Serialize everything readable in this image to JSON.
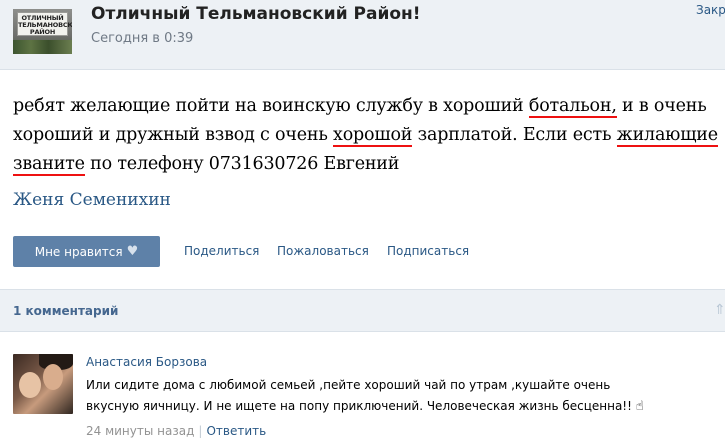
{
  "header": {
    "avatar_sign": "ОТЛИЧНЫЙ ТЕЛЬМАНОВСКИЙ РАЙОН",
    "group_name": "Отличный Тельмановский Район!",
    "time": "Сегодня в 0:39",
    "close_label": "Закр"
  },
  "post": {
    "segments": [
      {
        "text": "ребят желающие пойти на воинскую службу в хороший ",
        "spell": false
      },
      {
        "text": "ботальон,",
        "spell": true
      },
      {
        "text": " и в очень хороший и дружный взвод с очень ",
        "spell": false
      },
      {
        "text": "хорошой",
        "spell": true
      },
      {
        "text": " зарплатой. Если есть ",
        "spell": false
      },
      {
        "text": "жилающие",
        "spell": true
      },
      {
        "text": " ",
        "spell": false
      },
      {
        "text": "званите",
        "spell": true
      },
      {
        "text": " по телефону 0731630726 Евгений",
        "spell": false
      }
    ],
    "signer": "Женя Семенихин"
  },
  "actions": {
    "like_label": "Мне нравится",
    "like_icon": "heart-icon",
    "share": "Поделиться",
    "report": "Пожаловаться",
    "subscribe": "Подписаться"
  },
  "comments": {
    "count_label": "1 комментарий",
    "items": [
      {
        "author": "Анастасия Борзова",
        "text": "Или сидите дома с любимой семьей ,пейте хороший чай по утрам ,кушайте очень вкусную яичницу. И не ищете на попу приключений. Человеческая жизнь бесценна!! ",
        "gesture": "☝",
        "time": "24 минуты назад",
        "separator": "|",
        "reply_label": "Ответить"
      }
    ]
  },
  "colors": {
    "link": "#2a5885",
    "header_bg": "#edf1f5",
    "button_bg": "#5e81a8",
    "spell_underline": "#ee1111"
  }
}
